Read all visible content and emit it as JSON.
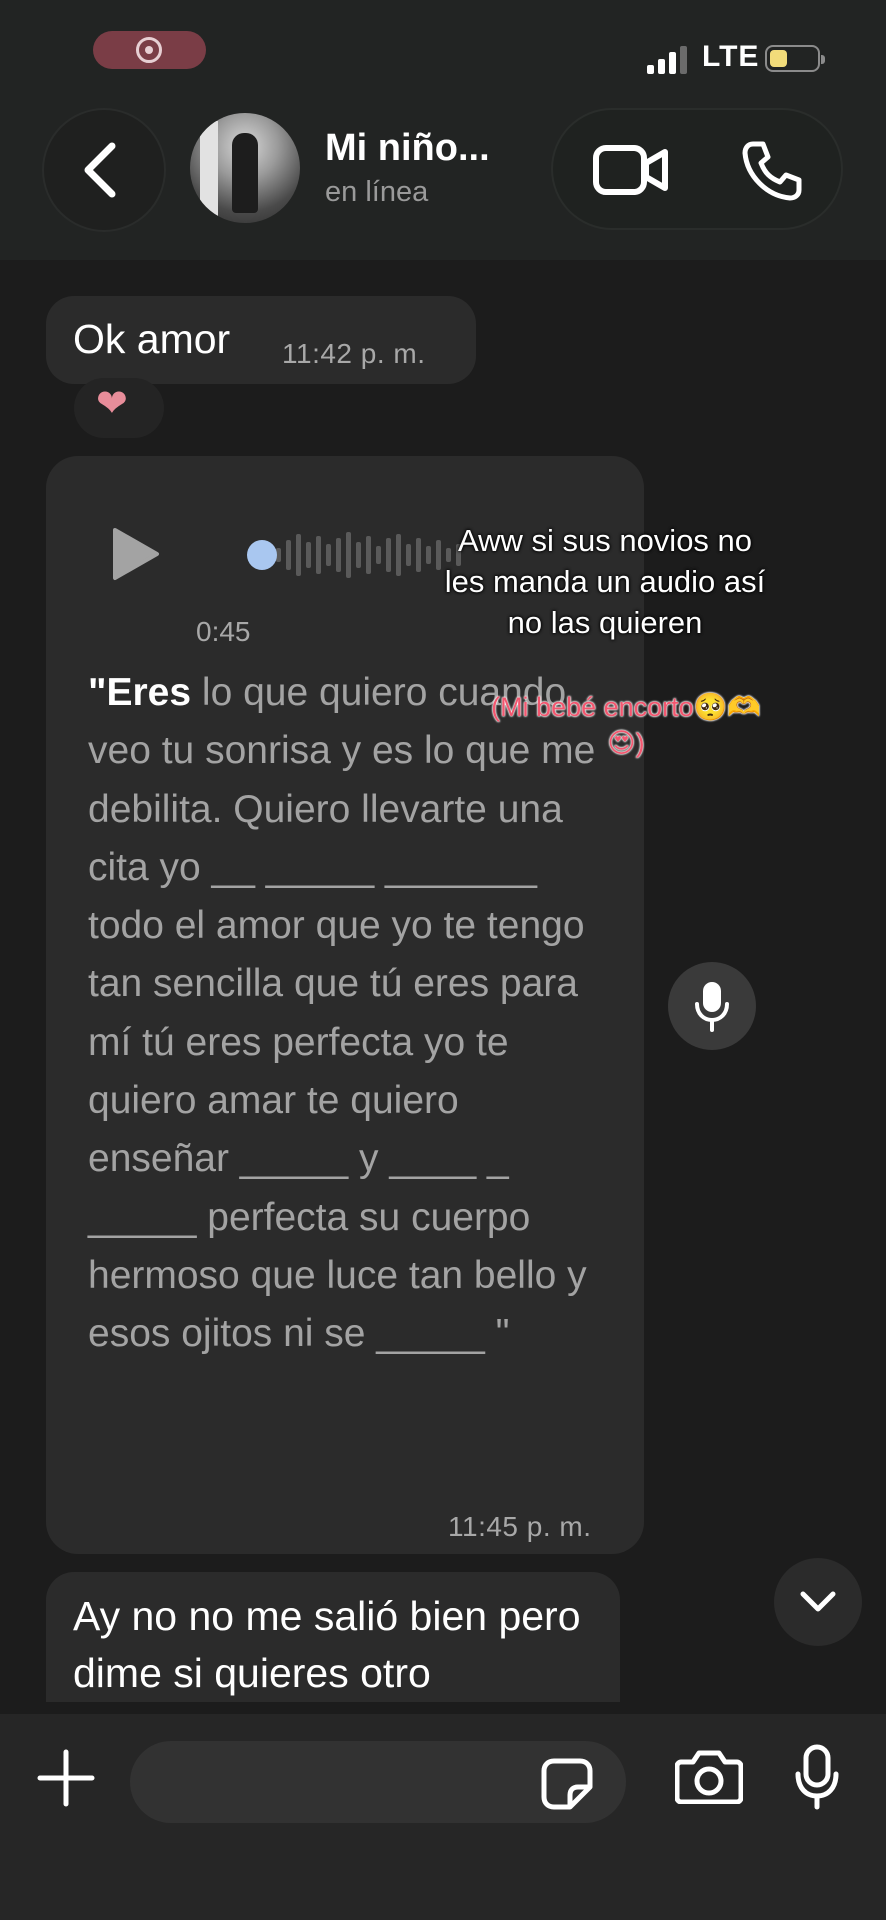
{
  "status_bar": {
    "network": "LTE"
  },
  "header": {
    "contact_name": "Mi niño...",
    "contact_status": "en línea"
  },
  "messages": [
    {
      "type": "text",
      "text": "Ok amor",
      "time": "11:42 p. m.",
      "reaction": "❤"
    },
    {
      "type": "voice",
      "duration": "0:45",
      "transcript_lead": "\"Eres",
      "transcript_rest": " lo que quiero cuando veo tu sonrisa y es lo que me debilita. Quiero llevarte una cita yo __ _____ _______ todo el amor que yo te tengo tan sencilla que tú eres para mí tú eres perfecta yo te quiero amar te quiero enseñar _____ y ____ _ _____ perfecta su cuerpo hermoso que luce tan bello y esos ojitos ni se _____ \"",
      "time": "11:45 p. m."
    },
    {
      "type": "text",
      "text": "Ay no no me salió bien pero dime si quieres otro"
    }
  ],
  "overlay": {
    "caption": "Aww si sus novios no les manda un audio así no las quieren",
    "sub_caption": "(Mi bebé encorto🥺🫶😍)"
  },
  "colors": {
    "background": "#1c1c1c",
    "bubble": "#2b2b2b",
    "accent_pink": "#f2576f",
    "waveform_dot": "#a9c7f0"
  },
  "icons": [
    "back-arrow-icon",
    "video-call-icon",
    "phone-icon",
    "play-icon",
    "microphone-icon",
    "chevron-down-icon",
    "plus-icon",
    "sticker-icon",
    "camera-icon"
  ]
}
